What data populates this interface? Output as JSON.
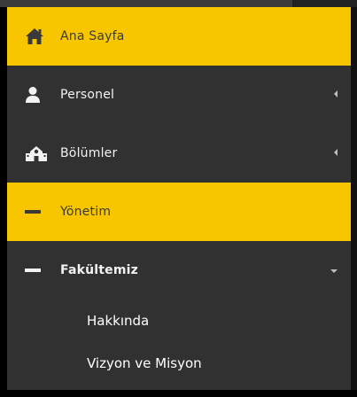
{
  "menu": {
    "items": [
      {
        "label": "Ana Sayfa",
        "icon": "home-icon"
      },
      {
        "label": "Personel",
        "icon": "user-icon"
      },
      {
        "label": "Bölümler",
        "icon": "building-icon"
      },
      {
        "label": "Yönetim",
        "icon": "minus-icon"
      },
      {
        "label": "Fakültemiz",
        "icon": "minus-icon"
      }
    ],
    "submenu": [
      {
        "label": "Hakkında"
      },
      {
        "label": "Vizyon ve Misyon"
      }
    ]
  },
  "colors": {
    "accent": "#f7c600",
    "sidebar_bg": "#313131",
    "text_light": "#f2f2f2",
    "text_dark": "#3a3a3a"
  }
}
